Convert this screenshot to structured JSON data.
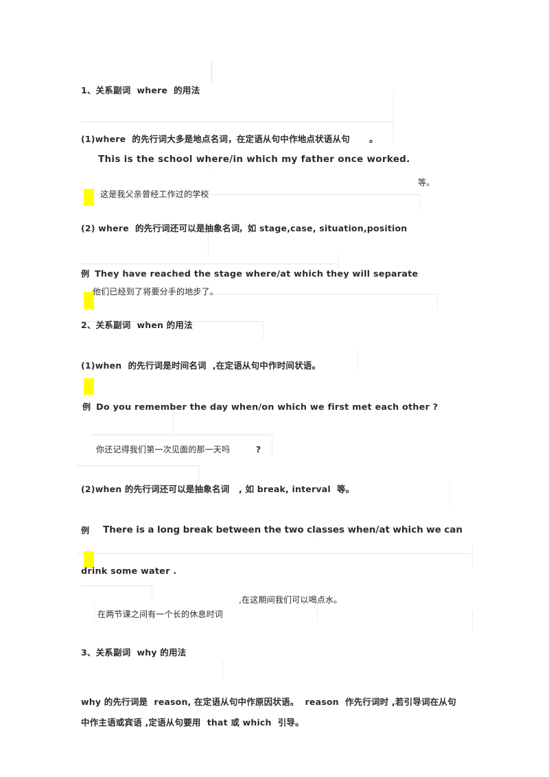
{
  "document": {
    "type": "scanned-study-notes",
    "language": "zh-CN + en",
    "topic": "关系副词 where / when / why 的用法",
    "highlight_color": "#ffff00",
    "text_color": "#2b2b2b",
    "background_color": "#ffffff",
    "rule_color": "#d9d9d9"
  },
  "sections": [
    {
      "id": "where",
      "heading": "1、关系副词  where  的用法",
      "points": [
        {
          "label": "(1)where  的先行词大多是地点名词，在定语从句中作地点状语从句",
          "trailing_period": "。",
          "example_en": "This is the school where/in which my father once worked.",
          "example_cn": "这是我父亲曾经工作过的学校"
        },
        {
          "label": "(2) where  的先行词还可以是抽象名词",
          "label_tail": "，如 stage,case, situation,position",
          "etc": "等。",
          "example_marker": "例",
          "example_en": "They have reached the stage where/at which they will separate",
          "example_cn": "他们已经到了将要分手的地步了。"
        }
      ]
    },
    {
      "id": "when",
      "heading": "2、关系副词  when 的用法",
      "points": [
        {
          "label": "(1)when  的先行词是时间名词  ,在定语从句中作时间状语。",
          "example_marker": "例",
          "example_en": "Do you remember the day when/on which we first met each other ?",
          "example_cn": "你还记得我们第一次见面的那一天吗",
          "example_cn_tail": "?"
        },
        {
          "label": "(2)when 的先行词还可以是抽象名词   , 如 break, interval  等。",
          "example_marker": "例",
          "example_en_words": [
            "There",
            "is",
            "a",
            "long",
            "break",
            "between",
            "the",
            "two",
            "classes",
            "when/at",
            "which",
            "we",
            "can"
          ],
          "example_en_cont": "drink some water .",
          "example_cn_top": ",在这期间我们可以喝点水。",
          "example_cn_bottom": "在两节课之间有一个长的休息时词"
        }
      ]
    },
    {
      "id": "why",
      "heading": "3、关系副词  why 的用法",
      "body_line_1": "why 的先行词是  reason, 在定语从句中作原因状语。  reason  作先行词时 ,若引导词在从句",
      "body_line_2": "中作主语或宾语 ,定语从句要用  that 或 which  引导。"
    }
  ]
}
